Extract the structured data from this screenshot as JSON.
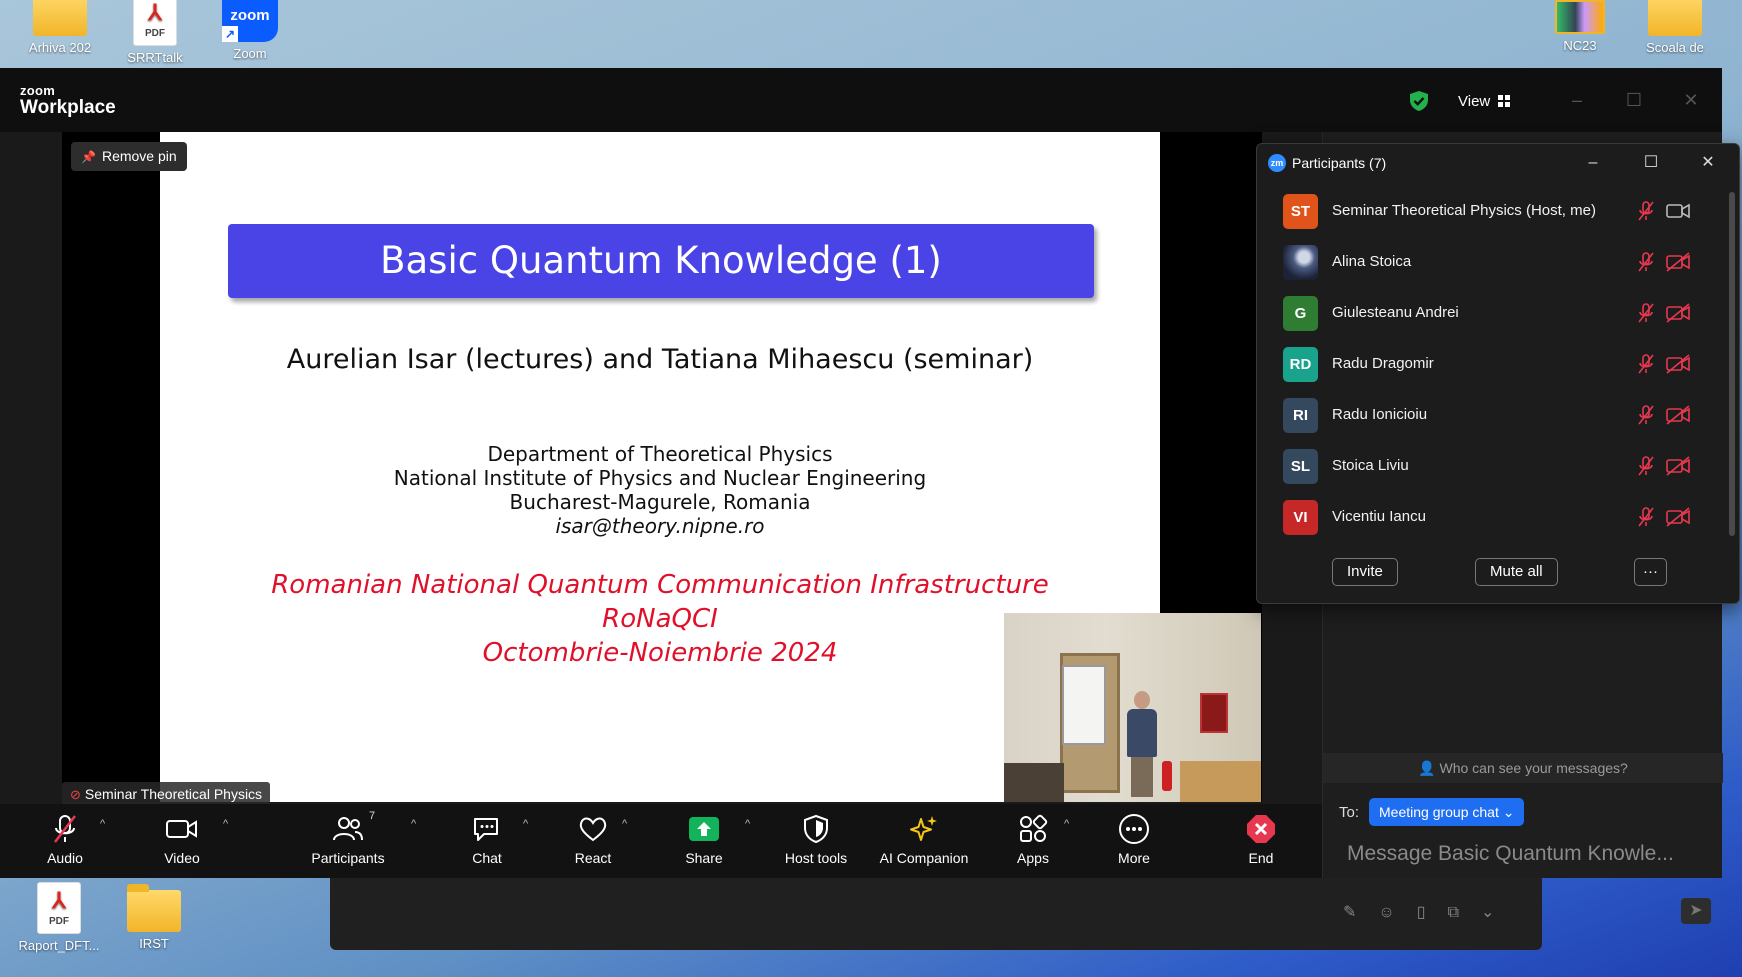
{
  "desktop": {
    "top_icons": [
      {
        "label": "Arhiva 202",
        "type": "folder"
      },
      {
        "label": "SRRTtalk",
        "type": "pdf"
      },
      {
        "label": "Zoom",
        "type": "zoom"
      },
      {
        "label": "NC23",
        "type": "thumb"
      },
      {
        "label": "Scoala de",
        "type": "folder"
      }
    ],
    "bottom_icons": [
      {
        "label": "Raport_DFT...",
        "type": "pdf"
      },
      {
        "label": "IRST",
        "type": "folder"
      }
    ],
    "pdf_text": "PDF",
    "zoom_text": "zoom"
  },
  "window": {
    "brand_top": "zoom",
    "brand_bottom": "Workplace",
    "view_label": "View",
    "security_color": "#22b14c"
  },
  "stage": {
    "remove_pin": "Remove pin",
    "speaker_tag": "Seminar Theoretical Physics"
  },
  "slide": {
    "title": "Basic Quantum Knowledge (1)",
    "authors": "Aurelian Isar (lectures) and Tatiana Mihaescu (seminar)",
    "affiliation": [
      "Department of Theoretical Physics",
      "National Institute of Physics and Nuclear Engineering",
      "Bucharest-Magurele, Romania"
    ],
    "email": "isar@theory.nipne.ro",
    "red_lines": [
      "Romanian National Quantum Communication Infrastructure",
      "RoNaQCI",
      "Octombrie-Noiembrie 2024"
    ],
    "title_bg": "#4a44e6",
    "red_color": "#e0102a"
  },
  "toolbar": {
    "audio": "Audio",
    "video": "Video",
    "participants": "Participants",
    "participants_count": "7",
    "chat": "Chat",
    "react": "React",
    "share": "Share",
    "host_tools": "Host tools",
    "ai_companion": "AI Companion",
    "apps": "Apps",
    "more": "More",
    "end": "End"
  },
  "participants_panel": {
    "title": "Participants (7)",
    "logo": "zm",
    "people": [
      {
        "initials": "ST",
        "name": "Seminar Theoretical Physics (Host, me)",
        "color": "#e0541b",
        "video": "on"
      },
      {
        "initials": "",
        "name": "Alina Stoica",
        "color": "photo",
        "video": "off"
      },
      {
        "initials": "G",
        "name": "Giulesteanu Andrei",
        "color": "#2f7d32",
        "video": "off"
      },
      {
        "initials": "RD",
        "name": "Radu Dragomir",
        "color": "#1aa38c",
        "video": "off"
      },
      {
        "initials": "RI",
        "name": "Radu Ionicioiu",
        "color": "#34495e",
        "video": "off"
      },
      {
        "initials": "SL",
        "name": "Stoica Liviu",
        "color": "#34495e",
        "video": "off"
      },
      {
        "initials": "VI",
        "name": "Vicentiu Iancu",
        "color": "#c62828",
        "video": "off"
      }
    ],
    "invite": "Invite",
    "mute_all": "Mute all",
    "more": "···"
  },
  "chat": {
    "who_can_see": "Who can see your messages?",
    "to_label": "To:",
    "recipient": "Meeting group chat",
    "placeholder": "Message Basic Quantum Knowle..."
  }
}
